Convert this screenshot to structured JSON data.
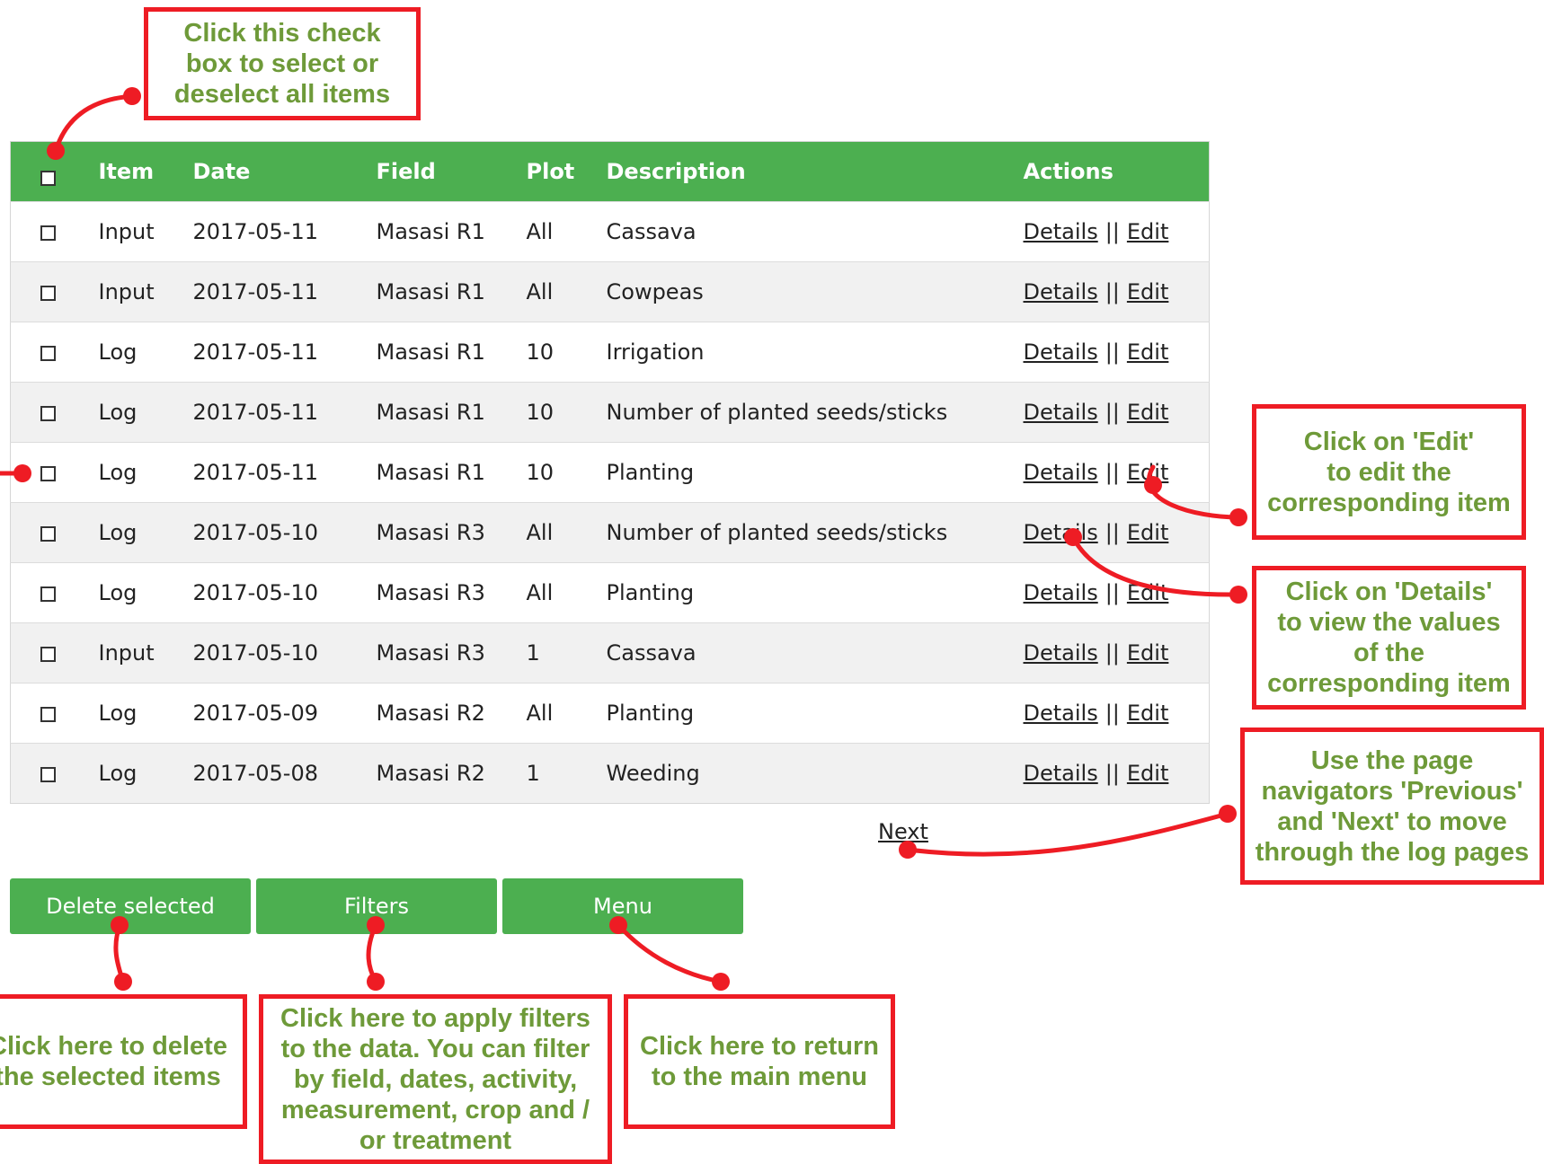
{
  "table": {
    "headers": [
      "Item",
      "Date",
      "Field",
      "Plot",
      "Description",
      "Actions"
    ],
    "rows": [
      {
        "item": "Input",
        "date": "2017-05-11",
        "field": "Masasi R1",
        "plot": "All",
        "description": "Cassava"
      },
      {
        "item": "Input",
        "date": "2017-05-11",
        "field": "Masasi R1",
        "plot": "All",
        "description": "Cowpeas"
      },
      {
        "item": "Log",
        "date": "2017-05-11",
        "field": "Masasi R1",
        "plot": "10",
        "description": "Irrigation"
      },
      {
        "item": "Log",
        "date": "2017-05-11",
        "field": "Masasi R1",
        "plot": "10",
        "description": "Number of planted seeds/sticks"
      },
      {
        "item": "Log",
        "date": "2017-05-11",
        "field": "Masasi R1",
        "plot": "10",
        "description": "Planting"
      },
      {
        "item": "Log",
        "date": "2017-05-10",
        "field": "Masasi R3",
        "plot": "All",
        "description": "Number of planted seeds/sticks"
      },
      {
        "item": "Log",
        "date": "2017-05-10",
        "field": "Masasi R3",
        "plot": "All",
        "description": "Planting"
      },
      {
        "item": "Input",
        "date": "2017-05-10",
        "field": "Masasi R3",
        "plot": "1",
        "description": "Cassava"
      },
      {
        "item": "Log",
        "date": "2017-05-09",
        "field": "Masasi R2",
        "plot": "All",
        "description": "Planting"
      },
      {
        "item": "Log",
        "date": "2017-05-08",
        "field": "Masasi R2",
        "plot": "1",
        "description": "Weeding"
      }
    ],
    "details_label": "Details",
    "separator": "||",
    "edit_label": "Edit"
  },
  "pagination": {
    "next_label": "Next"
  },
  "buttons": {
    "delete_label": "Delete selected",
    "filters_label": "Filters",
    "menu_label": "Menu"
  },
  "annotations": {
    "select_all": "Click this check\nbox to select or\ndeselect all items",
    "edit": "Click on 'Edit'\nto edit the\ncorresponding item",
    "details": "Click on 'Details'\nto view the values\nof the\ncorresponding item",
    "navigation": "Use the page\nnavigators 'Previous'\nand 'Next' to move\nthrough the log pages",
    "delete": "Click here to delete\nthe selected items",
    "filters": "Click here to apply filters\nto the data. You can filter\nby field, dates, activity,\nmeasurement, crop and /\nor treatment",
    "menu": "Click here to return\nto the main menu"
  },
  "colors": {
    "header_green": "#4caf50",
    "callout_red": "#ee1c24",
    "callout_text_green": "#6e9a39"
  }
}
